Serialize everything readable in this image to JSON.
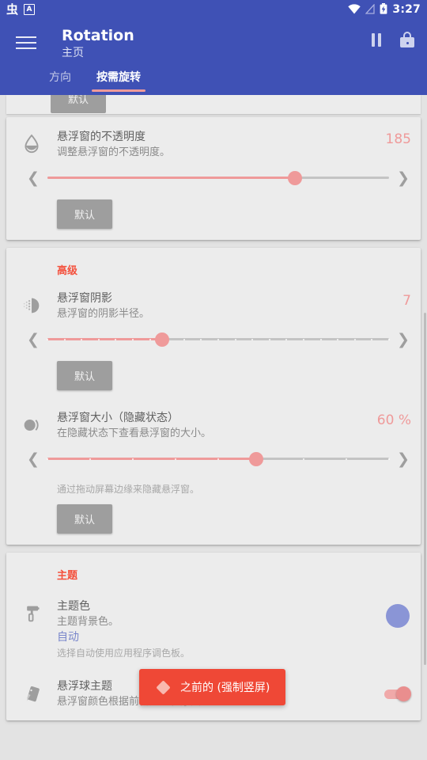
{
  "statusbar": {
    "left_icons": [
      {
        "name": "bug-notification-icon",
        "glyph": "虫"
      },
      {
        "name": "translate-notification-icon",
        "glyph": "A"
      }
    ],
    "wifi_icon": "wifi-icon",
    "signal_icon": "signal-off-icon",
    "battery_icon": "battery-charging-icon",
    "time": "3:27"
  },
  "appbar": {
    "menu_icon": "hamburger-menu-icon",
    "title": "Rotation",
    "subtitle": "主页",
    "pause_icon": "pause-icon",
    "lock_icon": "lock-icon",
    "tabs": [
      {
        "label": "方向",
        "active": false
      },
      {
        "label": "按需旋转",
        "active": true
      }
    ]
  },
  "clipped_button": {
    "label": "默认"
  },
  "cards": [
    {
      "id": "opacity-card",
      "section": null,
      "rows": [
        {
          "id": "opacity",
          "icon": "opacity-drop-icon",
          "title": "悬浮窗的不透明度",
          "subtitle": "调整悬浮窗的不透明度。",
          "value": "185",
          "slider": {
            "percent": 72.5,
            "ticks": 0,
            "prev_icon": "chevron-left-icon",
            "next_icon": "chevron-right-icon"
          },
          "default_button": "默认"
        }
      ]
    },
    {
      "id": "advanced-card",
      "section": "高级",
      "rows": [
        {
          "id": "bubble-shadow",
          "icon": "blur-shadow-icon",
          "title": "悬浮窗阴影",
          "subtitle": "悬浮窗的阴影半径。",
          "value": "7",
          "slider": {
            "percent": 33.5,
            "ticks": 20,
            "prev_icon": "chevron-left-icon",
            "next_icon": "chevron-right-icon"
          },
          "default_button": "默认"
        },
        {
          "id": "bubble-size-hidden",
          "icon": "bubble-size-icon",
          "title": "悬浮窗大小（隐藏状态）",
          "subtitle": "在隐藏状态下查看悬浮窗的大小。",
          "value": "60 %",
          "slider": {
            "percent": 61,
            "ticks": 8,
            "prev_icon": "chevron-left-icon",
            "next_icon": "chevron-right-icon"
          },
          "hint": "通过拖动屏幕边缘来隐藏悬浮窗。",
          "default_button": "默认"
        }
      ]
    },
    {
      "id": "theme-card",
      "section": "主题",
      "rows": [
        {
          "id": "theme-color",
          "icon": "paint-roller-icon",
          "title": "主题色",
          "subtitle": "主题背景色。",
          "link": "自动",
          "hint": "选择自动使用应用程序调色板。",
          "swatch_color": "#8a95d6"
        },
        {
          "id": "bubble-theme",
          "icon": "palette-card-icon",
          "title": "悬浮球主题",
          "subtitle": "悬浮窗颜色根据前台应用程序图标。",
          "toggle_on": true
        }
      ]
    }
  ],
  "toast": {
    "icon": "diamond-icon",
    "text": "之前的 (强制竖屏)"
  },
  "colors": {
    "primary": "#3f51b5",
    "accent_pink": "#ef9a9a",
    "section_red": "#f4503c",
    "toast_bg": "#ef4836",
    "card_bg": "#ececec",
    "page_bg": "#e3e3e3"
  }
}
